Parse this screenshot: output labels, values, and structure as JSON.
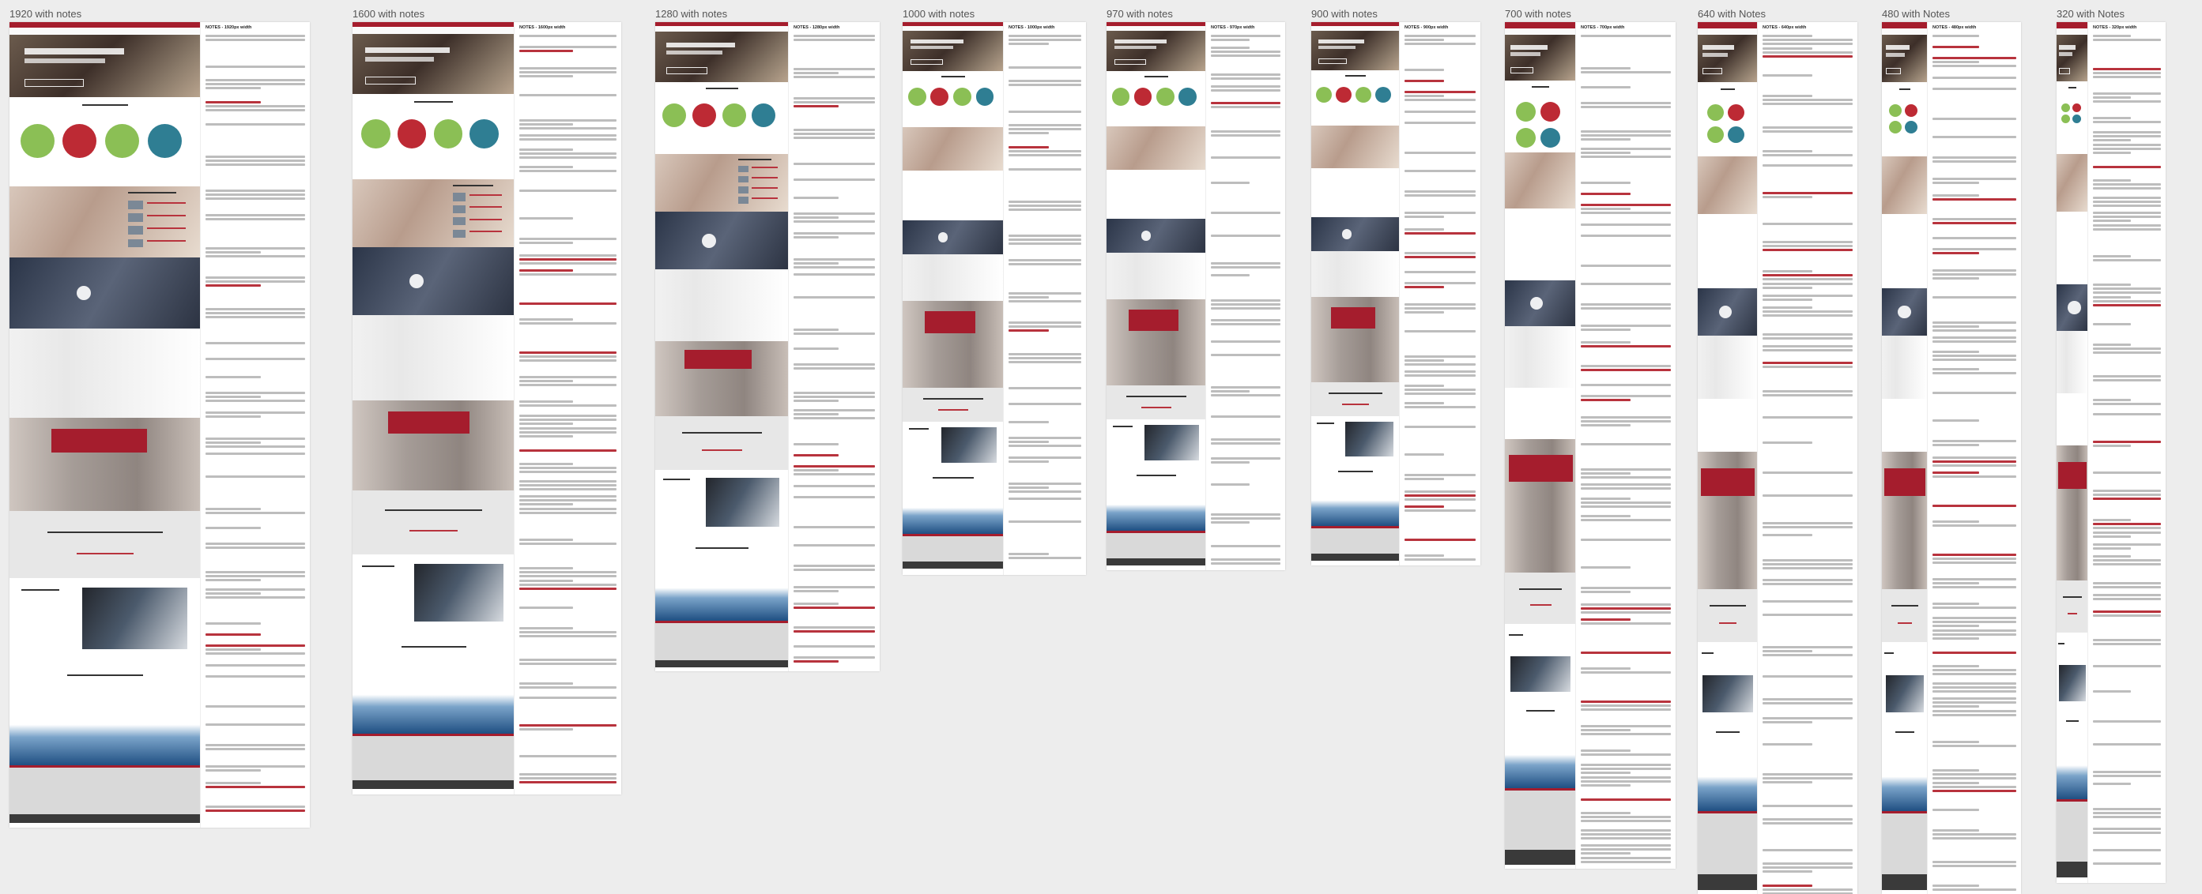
{
  "artboards": [
    {
      "label": "1920 with notes",
      "notes_title": "NOTES - 1920px width"
    },
    {
      "label": "1600 with notes",
      "notes_title": "NOTES - 1600px width"
    },
    {
      "label": "1280 with notes",
      "notes_title": "NOTES - 1280px width"
    },
    {
      "label": "1000 with notes",
      "notes_title": "NOTES - 1000px width"
    },
    {
      "label": "970 with notes",
      "notes_title": "NOTES - 970px width"
    },
    {
      "label": "900 with notes",
      "notes_title": "NOTES - 900px width"
    },
    {
      "label": "700 with notes",
      "notes_title": "NOTES - 700px width"
    },
    {
      "label": "640 with Notes",
      "notes_title": "NOTES - 640px width"
    },
    {
      "label": "480 with Notes",
      "notes_title": "NOTES - 480px width"
    },
    {
      "label": "320 with Notes",
      "notes_title": "NOTES - 320px width"
    }
  ],
  "colors": {
    "brand_red": "#a51d2d",
    "green": "#8bbf55",
    "teal": "#2f7e93",
    "canvas": "#ededed"
  }
}
